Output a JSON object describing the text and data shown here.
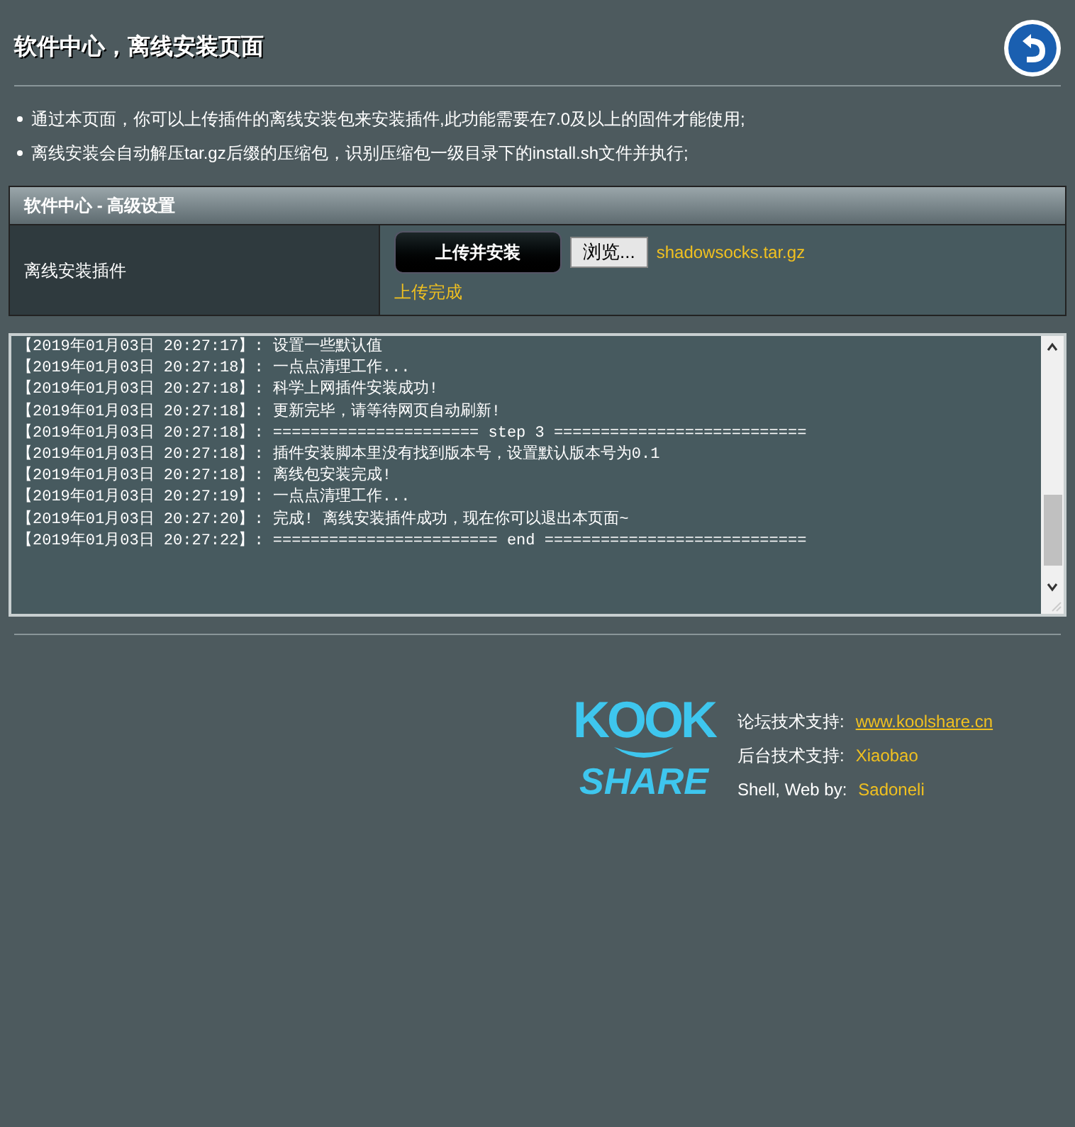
{
  "page": {
    "title": "软件中心，离线安装页面"
  },
  "notes": [
    "通过本页面，你可以上传插件的离线安装包来安装插件,此功能需要在7.0及以上的固件才能使用;",
    "离线安装会自动解压tar.gz后缀的压缩包，识别压缩包一级目录下的install.sh文件并执行;"
  ],
  "panel": {
    "header": "软件中心 - 高级设置",
    "row_label": "离线安装插件",
    "upload_button": "上传并安装",
    "browse_button": "浏览...",
    "file_name": "shadowsocks.tar.gz",
    "status": "上传完成"
  },
  "log": [
    "【2019年01月03日 20:27:17】: 设置一些默认值",
    "【2019年01月03日 20:27:18】: 一点点清理工作...",
    "【2019年01月03日 20:27:18】: 科学上网插件安装成功!",
    "【2019年01月03日 20:27:18】: 更新完毕，请等待网页自动刷新!",
    "【2019年01月03日 20:27:18】: ====================== step 3 ===========================",
    "【2019年01月03日 20:27:18】: 插件安装脚本里没有找到版本号，设置默认版本号为0.1",
    "【2019年01月03日 20:27:18】: 离线包安装完成!",
    "【2019年01月03日 20:27:19】: 一点点清理工作...",
    "【2019年01月03日 20:27:20】: 完成! 离线安装插件成功，现在你可以退出本页面~",
    "【2019年01月03日 20:27:22】: ======================== end ============================"
  ],
  "footer": {
    "logo_top": "KOOK",
    "logo_bottom": "SHARE",
    "credits": [
      {
        "label": "论坛技术支持:",
        "value": "www.koolshare.cn",
        "kind": "link"
      },
      {
        "label": "后台技术支持:",
        "value": "Xiaobao",
        "kind": "text"
      },
      {
        "label": "Shell, Web by:",
        "value": "Sadoneli",
        "kind": "text"
      }
    ]
  }
}
